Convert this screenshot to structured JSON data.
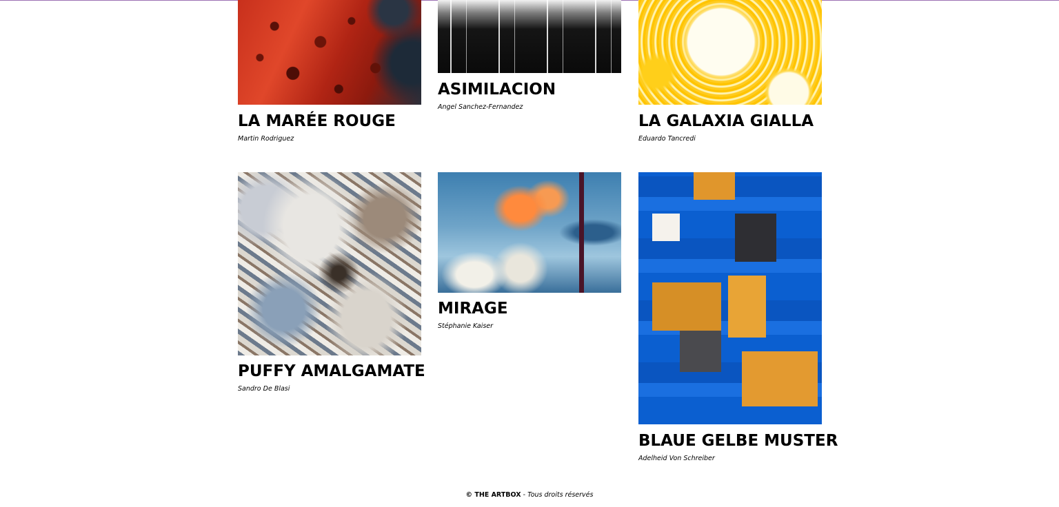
{
  "gallery": {
    "items": [
      {
        "title": "LA MARÉE ROUGE",
        "artist": "Martin Rodriguez",
        "image": "red-abstract-painting"
      },
      {
        "title": "ASIMILACION",
        "artist": "Angel Sanchez-Fernandez",
        "image": "black-white-abstract-painting"
      },
      {
        "title": "LA GALAXIA GIALLA",
        "artist": "Eduardo Tancredi",
        "image": "yellow-abstract-painting"
      },
      {
        "title": "PUFFY AMALGAMATE",
        "artist": "Sandro De Blasi",
        "image": "grey-swirl-abstract"
      },
      {
        "title": "MIRAGE",
        "artist": "Stéphanie Kaiser",
        "image": "blue-orange-abstract-painting"
      },
      {
        "title": "BLAUE GELBE MUSTER",
        "artist": "Adelheid Von Schreiber",
        "image": "blue-yellow-print"
      }
    ]
  },
  "footer": {
    "brand": "© THE ARTBOX",
    "separator": " - ",
    "rights": "Tous droits réservés"
  },
  "colors": {
    "top_border": "#9b6fb3",
    "text": "#000000",
    "background": "#ffffff"
  }
}
